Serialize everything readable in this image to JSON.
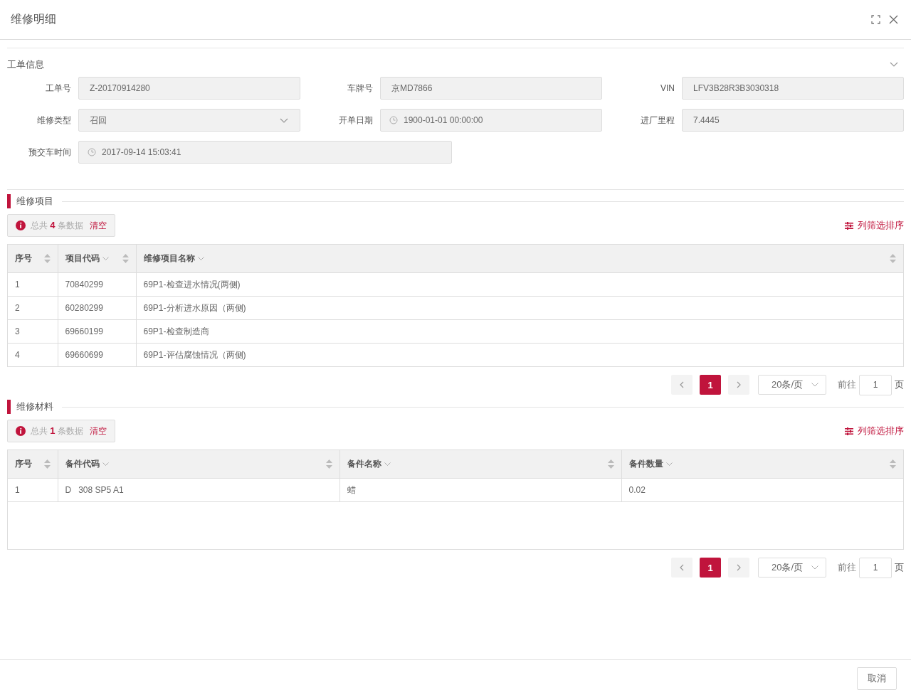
{
  "dialog": {
    "title": "维修明细"
  },
  "order_info": {
    "title": "工单信息",
    "expanded": true,
    "fields": [
      {
        "label": "工单号",
        "value": "Z-20170914280",
        "kind": "text"
      },
      {
        "label": "车牌号",
        "value": "京MD7866",
        "kind": "text"
      },
      {
        "label": "VIN",
        "value": "LFV3B28R3B3030318",
        "kind": "text"
      },
      {
        "label": "维修类型",
        "value": "召回",
        "kind": "select"
      },
      {
        "label": "开单日期",
        "value": "1900-01-01 00:00:00",
        "kind": "date"
      },
      {
        "label": "进厂里程",
        "value": "7.4445",
        "kind": "text"
      },
      {
        "label": "预交车时间",
        "value": "2017-09-14 15:03:41",
        "kind": "date",
        "wide": true
      }
    ]
  },
  "sections": [
    {
      "title": "维修项目",
      "summary": {
        "prefix": "总共",
        "count": "4",
        "suffix": "条数据",
        "clear": "清空"
      },
      "column_settings": "列筛选排序",
      "columns": [
        {
          "label": "序号",
          "filter": false,
          "sortable": true
        },
        {
          "label": "项目代码",
          "filter": true,
          "sortable": true
        },
        {
          "label": "维修项目名称",
          "filter": true,
          "sortable": true
        }
      ],
      "rows": [
        [
          "1",
          "70840299",
          "69P1-检查进水情况(两侧)"
        ],
        [
          "2",
          "60280299",
          "69P1-分析进水原因（两侧)"
        ],
        [
          "3",
          "69660199",
          "69P1-检查制造商"
        ],
        [
          "4",
          "69660699",
          "69P1-评估腐蚀情况（两侧)"
        ]
      ],
      "pagination": {
        "pages": [
          {
            "label": "1",
            "selected": true
          }
        ],
        "page_size": "20条/页",
        "goto_label": "前往",
        "goto_value": "1",
        "goto_unit": "页"
      }
    },
    {
      "title": "维修材料",
      "summary": {
        "prefix": "总共",
        "count": "1",
        "suffix": "条数据",
        "clear": "清空"
      },
      "column_settings": "列筛选排序",
      "columns": [
        {
          "label": "序号",
          "filter": false,
          "sortable": true
        },
        {
          "label": "备件代码",
          "filter": true,
          "sortable": true
        },
        {
          "label": "备件名称",
          "filter": true,
          "sortable": true
        },
        {
          "label": "备件数量",
          "filter": true,
          "sortable": true
        }
      ],
      "rows": [
        [
          "1",
          "D   308 SP5 A1",
          "蜡",
          "0.02"
        ]
      ],
      "pagination": {
        "pages": [
          {
            "label": "1",
            "selected": true
          }
        ],
        "page_size": "20条/页",
        "goto_label": "前往",
        "goto_value": "1",
        "goto_unit": "页"
      }
    }
  ],
  "footer": {
    "buttons": [
      "取消"
    ]
  }
}
